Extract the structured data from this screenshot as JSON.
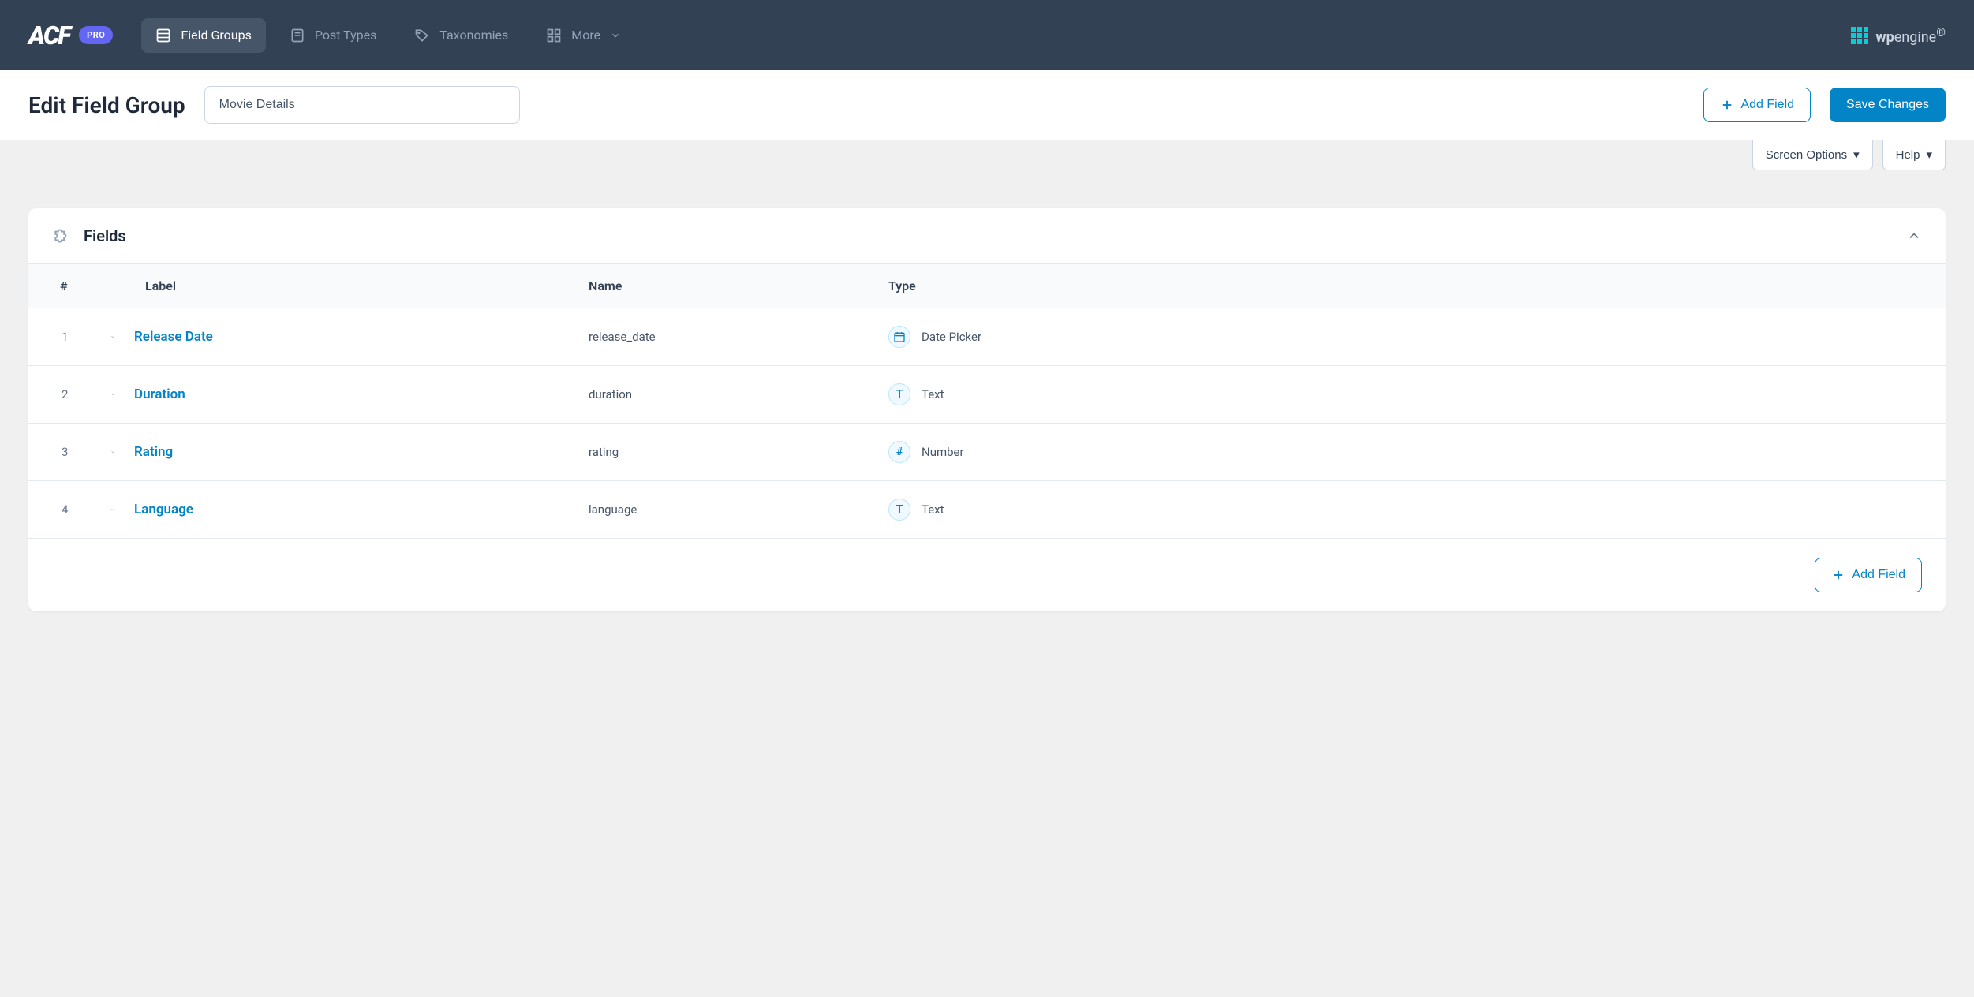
{
  "brand": {
    "logo": "ACF",
    "badge": "PRO"
  },
  "nav": {
    "field_groups": "Field Groups",
    "post_types": "Post Types",
    "taxonomies": "Taxonomies",
    "more": "More"
  },
  "wpengine": {
    "prefix": "wp",
    "suffix": "engine"
  },
  "header": {
    "title": "Edit Field Group",
    "group_name": "Movie Details",
    "add_field": "Add Field",
    "save": "Save Changes"
  },
  "options": {
    "screen_options": "Screen Options",
    "help": "Help"
  },
  "panel": {
    "title": "Fields",
    "columns": {
      "num": "#",
      "label": "Label",
      "name": "Name",
      "type": "Type"
    },
    "rows": [
      {
        "num": "1",
        "label": "Release Date",
        "name": "release_date",
        "type": "Date Picker",
        "icon": "calendar"
      },
      {
        "num": "2",
        "label": "Duration",
        "name": "duration",
        "type": "Text",
        "icon": "T"
      },
      {
        "num": "3",
        "label": "Rating",
        "name": "rating",
        "type": "Number",
        "icon": "#"
      },
      {
        "num": "4",
        "label": "Language",
        "name": "language",
        "type": "Text",
        "icon": "T"
      }
    ],
    "footer_add": "Add Field"
  }
}
